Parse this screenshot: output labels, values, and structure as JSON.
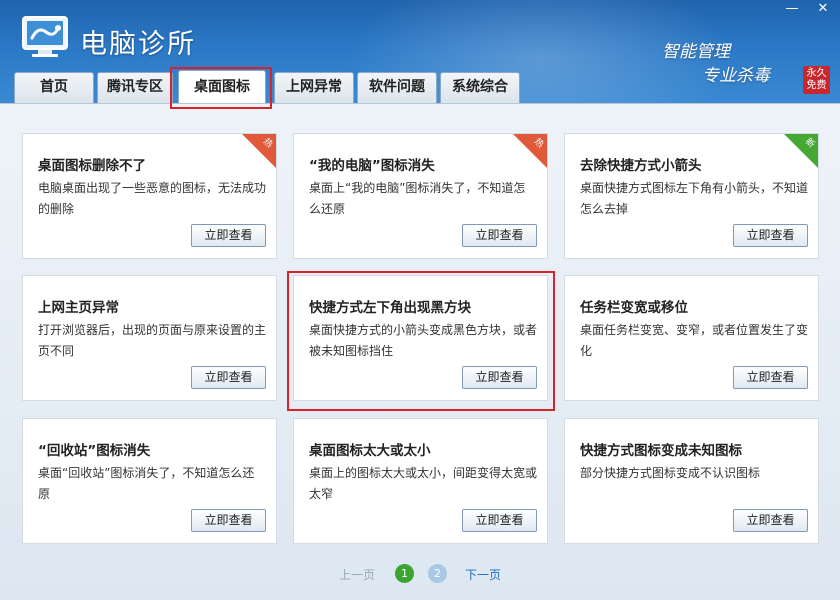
{
  "app": {
    "title": "电脑诊所",
    "slogan_line1": "智能管理",
    "slogan_line2": "专业杀毒",
    "free_badge_line1": "永久",
    "free_badge_line2": "免费"
  },
  "window_controls": {
    "minimize": "—",
    "close": "✕"
  },
  "tabs": [
    {
      "label": "首页",
      "active": false
    },
    {
      "label": "腾讯专区",
      "active": false
    },
    {
      "label": "桌面图标",
      "active": true
    },
    {
      "label": "上网异常",
      "active": false
    },
    {
      "label": "软件问题",
      "active": false
    },
    {
      "label": "系统综合",
      "active": false
    }
  ],
  "cards": [
    {
      "title": "桌面图标删除不了",
      "desc": "电脑桌面出现了一些恶意的图标，无法成功的删除",
      "button": "立即查看",
      "tag": "热"
    },
    {
      "title": "“我的电脑”图标消失",
      "desc": "桌面上“我的电脑”图标消失了，不知道怎么还原",
      "button": "立即查看",
      "tag": "热"
    },
    {
      "title": "去除快捷方式小箭头",
      "desc": "桌面快捷方式图标左下角有小箭头，不知道怎么去掉",
      "button": "立即查看",
      "tag": "新"
    },
    {
      "title": "上网主页异常",
      "desc": "打开浏览器后，出现的页面与原来设置的主页不同",
      "button": "立即查看",
      "tag": ""
    },
    {
      "title": "快捷方式左下角出现黑方块",
      "desc": "桌面快捷方式的小箭头变成黑色方块，或者被未知图标挡住",
      "button": "立即查看",
      "tag": ""
    },
    {
      "title": "任务栏变宽或移位",
      "desc": "桌面任务栏变宽、变窄，或者位置发生了变化",
      "button": "立即查看",
      "tag": ""
    },
    {
      "title": "“回收站”图标消失",
      "desc": "桌面“回收站”图标消失了，不知道怎么还原",
      "button": "立即查看",
      "tag": ""
    },
    {
      "title": "桌面图标太大或太小",
      "desc": "桌面上的图标太大或太小，间距变得太宽或太窄",
      "button": "立即查看",
      "tag": ""
    },
    {
      "title": "快捷方式图标变成未知图标",
      "desc": "部分快捷方式图标变成不认识图标",
      "button": "立即查看",
      "tag": ""
    }
  ],
  "pagination": {
    "prev": "上一页",
    "pages": [
      "1",
      "2"
    ],
    "current": "1",
    "next": "下一页"
  },
  "colors": {
    "header": "#2b78c6",
    "highlight": "#d8232a",
    "tag_hot": "#e05a3a",
    "tag_new": "#45a832",
    "page_current": "#3aa531"
  }
}
